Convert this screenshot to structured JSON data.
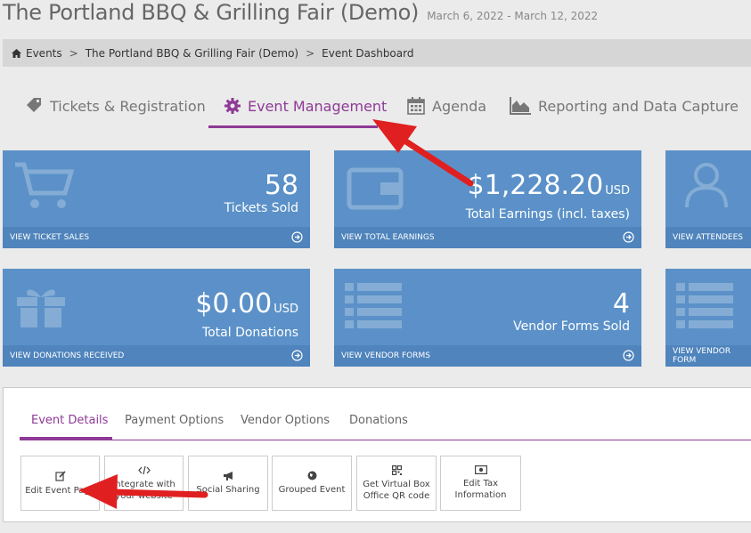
{
  "header": {
    "title": "The Portland BBQ & Grilling Fair (Demo)",
    "dates": "March 6, 2022 - March 12, 2022"
  },
  "breadcrumb": {
    "items": [
      "Events",
      "The Portland BBQ & Grilling Fair (Demo)",
      "Event Dashboard"
    ],
    "separator": ">"
  },
  "tabs": [
    {
      "label": "Tickets & Registration",
      "icon": "tag-icon"
    },
    {
      "label": "Event Management",
      "icon": "gear-icon",
      "active": true
    },
    {
      "label": "Agenda",
      "icon": "calendar-icon"
    },
    {
      "label": "Reporting and Data Capture",
      "icon": "area-chart-icon"
    }
  ],
  "tiles": [
    {
      "value": "58",
      "unit": "",
      "label": "Tickets Sold",
      "footer": "VIEW TICKET SALES",
      "icon": "cart-icon"
    },
    {
      "value": "$1,228.20",
      "unit": "USD",
      "label": "Total Earnings (incl. taxes)",
      "footer": "VIEW TOTAL EARNINGS",
      "icon": "wallet-icon"
    },
    {
      "value": "",
      "unit": "",
      "label": "",
      "footer": "VIEW ATTENDEES",
      "icon": "users-icon"
    },
    {
      "value": "$0.00",
      "unit": "USD",
      "label": "Total Donations",
      "footer": "VIEW DONATIONS RECEIVED",
      "icon": "gift-icon"
    },
    {
      "value": "4",
      "unit": "",
      "label": "Vendor Forms Sold",
      "footer": "VIEW VENDOR FORMS",
      "icon": "list-icon"
    },
    {
      "value": "",
      "unit": "",
      "label": "",
      "footer": "VIEW VENDOR FORM",
      "icon": "list-icon"
    }
  ],
  "subtabs": [
    "Event Details",
    "Payment Options",
    "Vendor Options",
    "Donations"
  ],
  "buttons": [
    {
      "label": "Edit Event Page",
      "icon": "edit-icon"
    },
    {
      "label": "Integrate with\nyour website",
      "icon": "code-icon"
    },
    {
      "label": "Social Sharing",
      "icon": "bullhorn-icon"
    },
    {
      "label": "Grouped Event",
      "icon": "globe-icon"
    },
    {
      "label": "Get Virtual Box\nOffice QR code",
      "icon": "qrcode-icon"
    },
    {
      "label": "Edit Tax\nInformation",
      "icon": "money-icon"
    }
  ],
  "colors": {
    "accent": "#8e3a96",
    "tile": "#5b91c8",
    "tile_footer": "#4f84bc",
    "arrow": "#e02020"
  }
}
